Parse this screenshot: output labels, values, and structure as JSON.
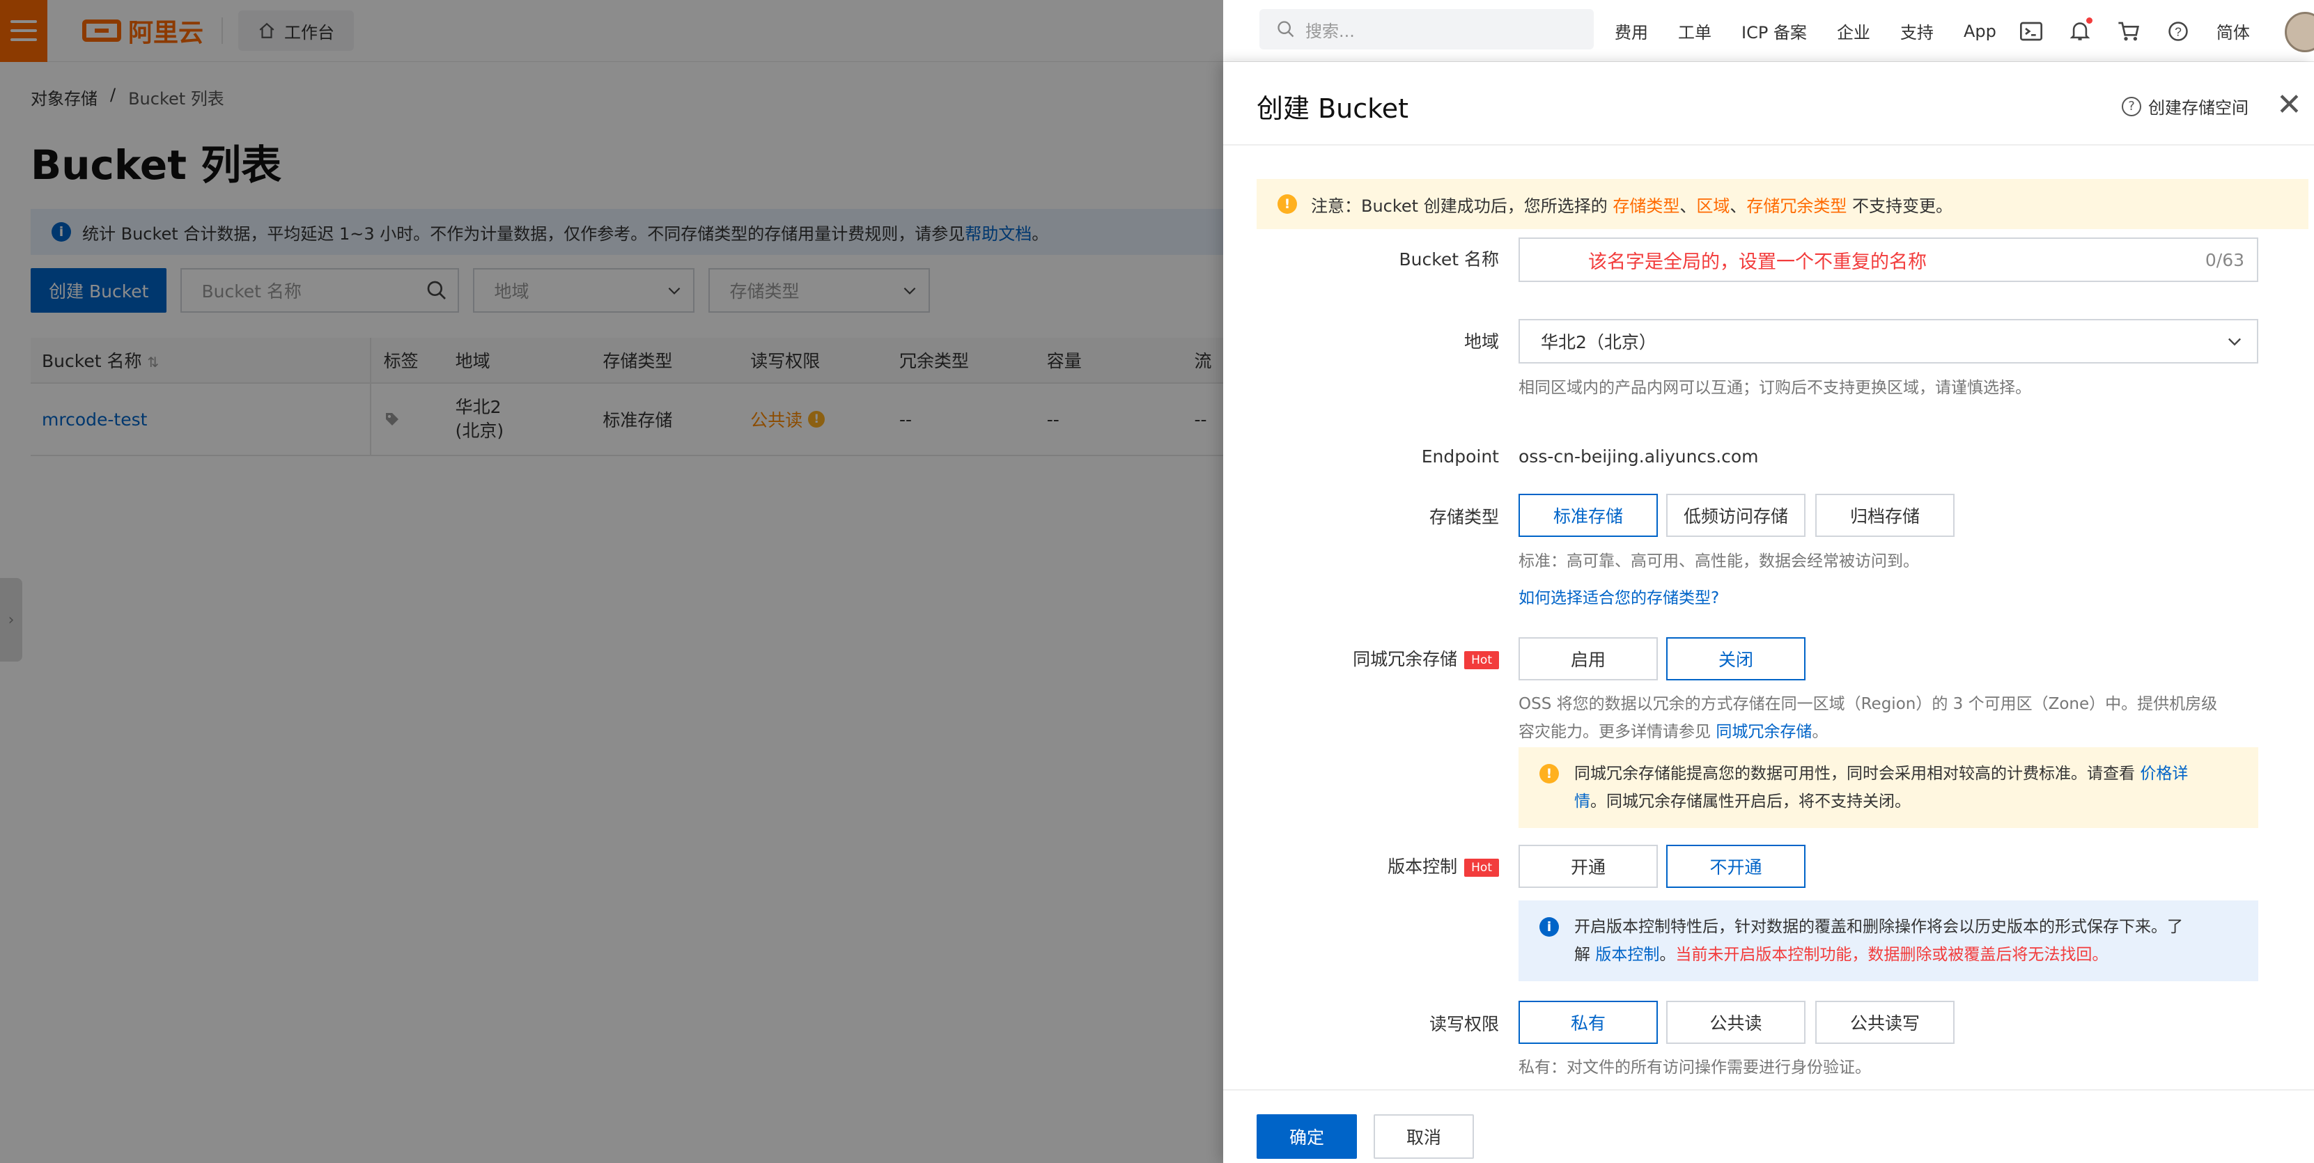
{
  "topbar": {
    "brand": "阿里云",
    "workbench": "工作台",
    "search_placeholder": "搜索...",
    "links": [
      "费用",
      "工单",
      "ICP 备案",
      "企业",
      "支持",
      "App"
    ],
    "lang": "简体"
  },
  "main": {
    "breadcrumb": [
      "对象存储",
      "/",
      "Bucket 列表"
    ],
    "title": "Bucket 列表",
    "banner_text": "统计 Bucket 合计数据，平均延迟 1~3 小时。不作为计量数据，仅作参考。不同存储类型的存储用量计费规则，请参见",
    "banner_link": "帮助文档",
    "banner_end": "。",
    "create_button": "创建 Bucket",
    "name_filter_placeholder": "Bucket 名称",
    "region_filter": "地域",
    "storage_filter": "存储类型",
    "columns": [
      "Bucket 名称",
      "标签",
      "地域",
      "存储类型",
      "读写权限",
      "冗余类型",
      "容量",
      "流"
    ],
    "rows": [
      {
        "name": "mrcode-test",
        "region_line1": "华北2",
        "region_line2": "(北京)",
        "storage": "标准存储",
        "acl": "公共读",
        "redundancy": "--",
        "capacity": "--",
        "flow": "--"
      }
    ]
  },
  "drawer": {
    "title": "创建 Bucket",
    "help_link": "创建存储空间",
    "notice_prefix": "注意：Bucket 创建成功后，您所选择的",
    "notice_storage": "存储类型",
    "notice_sep1": "、",
    "notice_region": "区域",
    "notice_sep2": "、",
    "notice_redundancy": "存储冗余类型",
    "notice_suffix": "不支持变更。",
    "name_label": "Bucket 名称",
    "name_hint": "该名字是全局的，设置一个不重复的名称",
    "name_count": "0/63",
    "region_label": "地域",
    "region_value": "华北2（北京）",
    "region_help": "相同区域内的产品内网可以互通；订购后不支持更换区域，请谨慎选择。",
    "endpoint_label": "Endpoint",
    "endpoint_value": "oss-cn-beijing.aliyuncs.com",
    "storage_label": "存储类型",
    "storage_options": [
      "标准存储",
      "低频访问存储",
      "归档存储"
    ],
    "storage_help": "标准：高可靠、高可用、高性能，数据会经常被访问到。",
    "storage_link": "如何选择适合您的存储类型?",
    "zrs_label": "同城冗余存储",
    "hot": "Hot",
    "zrs_options": [
      "启用",
      "关闭"
    ],
    "zrs_help_1": "OSS 将您的数据以冗余的方式存储在同一区域（Region）的 3 个可用区（Zone）中。提供机房级",
    "zrs_help_2": "容灾能力。更多详情请参见",
    "zrs_help_link": "同城冗余存储",
    "zrs_help_end": "。",
    "zrs_warn_1": "同城冗余存储能提高您的数据可用性，同时会采用相对较高的计费标准。请查看",
    "zrs_warn_link_1": "价格详",
    "zrs_warn_link_2": "情",
    "zrs_warn_2": "。同城冗余存储属性开启后，将不支持关闭。",
    "version_label": "版本控制",
    "version_options": [
      "开通",
      "不开通"
    ],
    "version_info_1": "开启版本控制特性后，针对数据的覆盖和删除操作将会以历史版本的形式保存下来。了",
    "version_info_2a": "解",
    "version_info_link": "版本控制",
    "version_info_2b": "。",
    "version_info_red": "当前未开启版本控制功能，数据删除或被覆盖后将无法找回。",
    "acl_label": "读写权限",
    "acl_options": [
      "私有",
      "公共读",
      "公共读写"
    ],
    "acl_help": "私有：对文件的所有访问操作需要进行身份验证。",
    "ok_button": "确定",
    "cancel_button": "取消"
  },
  "colors": {
    "accent": "#0064c8",
    "brand": "#ff6a00",
    "warning": "#ffb01f",
    "danger": "#f23c3c"
  }
}
